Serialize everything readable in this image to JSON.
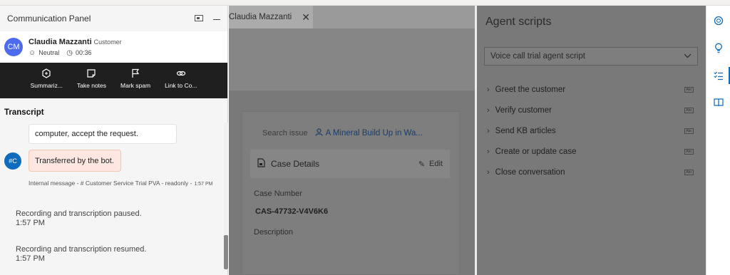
{
  "comm_panel": {
    "title": "Communication Panel",
    "customer": {
      "initials": "CM",
      "name": "Claudia Mazzanti",
      "role": "Customer",
      "sentiment": "Neutral",
      "timer": "00:36"
    },
    "actions": [
      {
        "label": "Summariz...",
        "icon": "summarize-icon"
      },
      {
        "label": "Take notes",
        "icon": "notes-icon"
      },
      {
        "label": "Mark spam",
        "icon": "flag-icon"
      },
      {
        "label": "Link to Co...",
        "icon": "link-icon"
      }
    ],
    "transcript": {
      "heading": "Transcript",
      "prev_message": "computer, accept the request.",
      "bot_initials": "#C",
      "bot_message": "Transferred by the bot.",
      "internal_note": "Internal message - # Customer Service Trial PVA - readonly -",
      "internal_time": "1:57 PM",
      "system_messages": [
        {
          "text": "Recording and transcription paused.",
          "time": "1:57 PM"
        },
        {
          "text": "Recording and transcription resumed.",
          "time": "1:57 PM"
        }
      ]
    }
  },
  "center": {
    "tab_label": "Claudia Mazzanti",
    "search_label": "Search issue",
    "case_title": "A Mineral Build Up in Wa...",
    "details_title": "Case Details",
    "edit_label": "Edit",
    "case_number_label": "Case Number",
    "case_number": "CAS-47732-V4V6K6",
    "description_label": "Description"
  },
  "agent_scripts": {
    "title": "Agent scripts",
    "selected_script": "Voice call trial agent script",
    "steps": [
      "Greet the customer",
      "Verify customer",
      "Send KB articles",
      "Create or update case",
      "Close conversation"
    ]
  },
  "colors": {
    "accent": "#0f6cbd",
    "avatar": "#4f6bed",
    "action_bar": "#1f1f1f",
    "bot_bubble": "#fde7e0",
    "overlay": "#797979"
  }
}
